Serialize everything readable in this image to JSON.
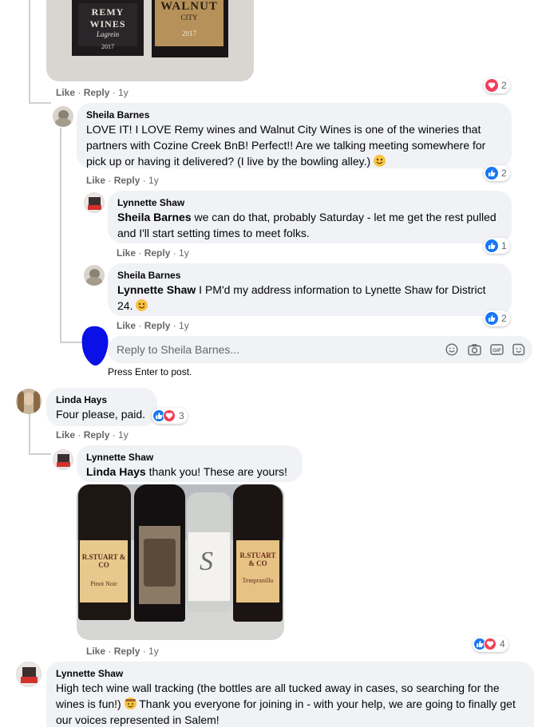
{
  "comments": [
    {
      "id": "c0",
      "meta": {
        "like": "Like",
        "reply": "Reply",
        "time": "1y"
      },
      "reaction_count": "2"
    },
    {
      "id": "c1",
      "author": "Sheila Barnes",
      "text": "LOVE IT! I LOVE Remy wines and Walnut City Wines is one of the wineries that partners with Cozine Creek BnB! Perfect!! Are we talking meeting somewhere for pick up or having it delivered? (I live by the bowling alley.)",
      "meta": {
        "like": "Like",
        "reply": "Reply",
        "time": "1y"
      },
      "reaction_count": "2"
    },
    {
      "id": "c2",
      "author": "Lynnette Shaw",
      "mention": "Sheila Barnes",
      "text": " we can do that, probably Saturday - let me get the rest pulled and I'll start setting times to meet folks.",
      "meta": {
        "like": "Like",
        "reply": "Reply",
        "time": "1y"
      },
      "reaction_count": "1"
    },
    {
      "id": "c3",
      "author": "Sheila Barnes",
      "mention": "Lynnette Shaw",
      "text": " I PM'd my address information to Lynette Shaw for District 24.",
      "meta": {
        "like": "Like",
        "reply": "Reply",
        "time": "1y"
      },
      "reaction_count": "2"
    },
    {
      "id": "c4",
      "author": "Linda Hays",
      "text": "Four please, paid.",
      "meta": {
        "like": "Like",
        "reply": "Reply",
        "time": "1y"
      },
      "reaction_count": "3"
    },
    {
      "id": "c5",
      "author": "Lynnette Shaw",
      "mention": "Linda Hays",
      "text": " thank you! These are yours!",
      "meta": {
        "like": "Like",
        "reply": "Reply",
        "time": "1y"
      },
      "reaction_count": "4"
    },
    {
      "id": "c6",
      "author": "Lynnette Shaw",
      "text_1": "High tech wine wall tracking (the bottles are all tucked away in cases, so searching for the wines is fun!)",
      "text_2": " Thank you everyone for joining in - with your help, we are going to finally get our voices represented in Salem!"
    }
  ],
  "reply_box": {
    "placeholder": "Reply to Sheila Barnes...",
    "hint": "Press Enter to post."
  },
  "photo_top": {
    "label_left": "REMY WINES",
    "label_left_sub": "Lagrein",
    "label_right": "WALNUT",
    "label_right_sub": "CITY",
    "year_left": "2017",
    "year_right": "2017"
  },
  "photo_bottom": {
    "label_1": "R.STUART & CO",
    "label_1_sub": "Pinot Noir",
    "label_4": "R.STUART & CO",
    "label_4_sub": "Tempranillo"
  },
  "colors": {
    "like": "#1877f2",
    "love": "#f33e58",
    "bubble": "#f0f2f5",
    "meta": "#65676b"
  }
}
